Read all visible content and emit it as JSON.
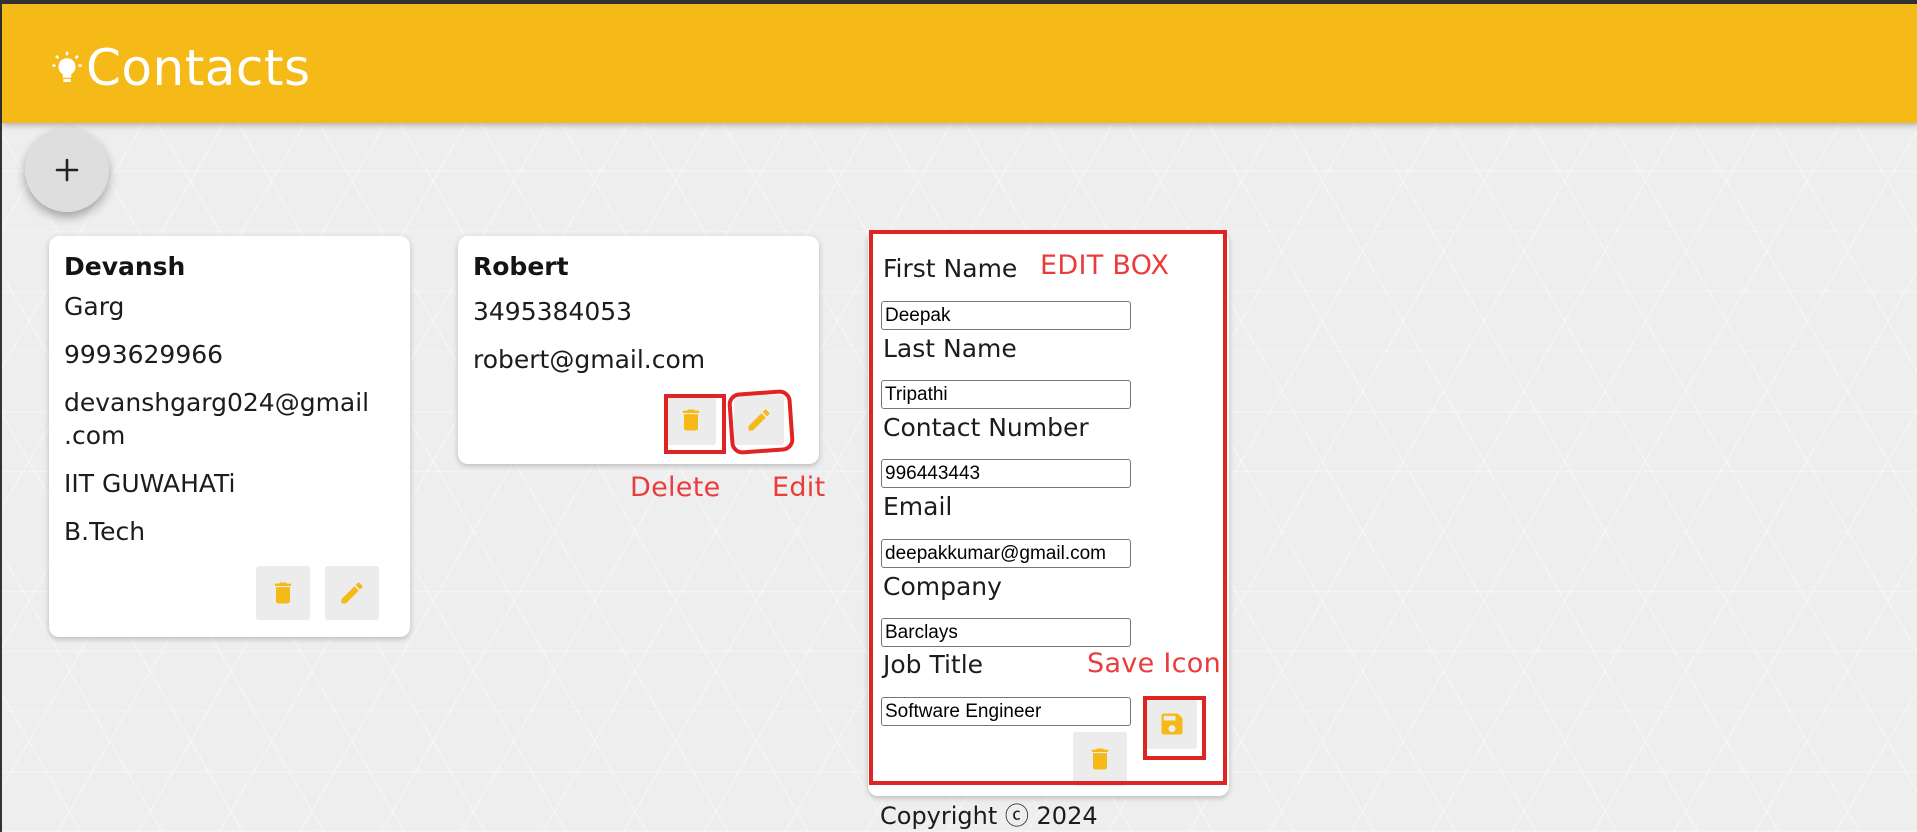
{
  "app": {
    "title": "Contacts",
    "logo_icon": "lightbulb-icon"
  },
  "toolbar": {
    "add_icon": "plus-icon"
  },
  "colors": {
    "brand": "#f5ba18",
    "icon": "#f5ba18",
    "annotation": "#ea3c3c"
  },
  "contacts": [
    {
      "name": "Devansh",
      "lines": [
        "Garg",
        "9993629966",
        "devanshgarg024@gmail",
        ".com",
        "IIT GUWAHATi",
        "B.Tech"
      ],
      "actions": [
        "trash-icon",
        "pencil-icon"
      ]
    },
    {
      "name": "Robert",
      "lines": [
        "3495384053",
        "robert@gmail.com"
      ],
      "actions": [
        "trash-icon",
        "pencil-icon"
      ]
    }
  ],
  "edit_form": {
    "fields": [
      {
        "label": "First Name",
        "value": "Deepak"
      },
      {
        "label": "Last Name",
        "value": "Tripathi"
      },
      {
        "label": "Contact Number",
        "value": "996443443"
      },
      {
        "label": "Email",
        "value": "deepakkumar@gmail.com"
      },
      {
        "label": "Company",
        "value": "Barclays"
      },
      {
        "label": "Job Title",
        "value": "Software Engineer"
      }
    ],
    "actions": [
      "trash-icon",
      "save-icon"
    ]
  },
  "annotations": {
    "edit_box": "EDIT  BOX",
    "delete": "Delete",
    "edit": "Edit",
    "save_icon": "Save Icon"
  },
  "footer": {
    "copyright": "Copyright ⓒ 2024"
  }
}
